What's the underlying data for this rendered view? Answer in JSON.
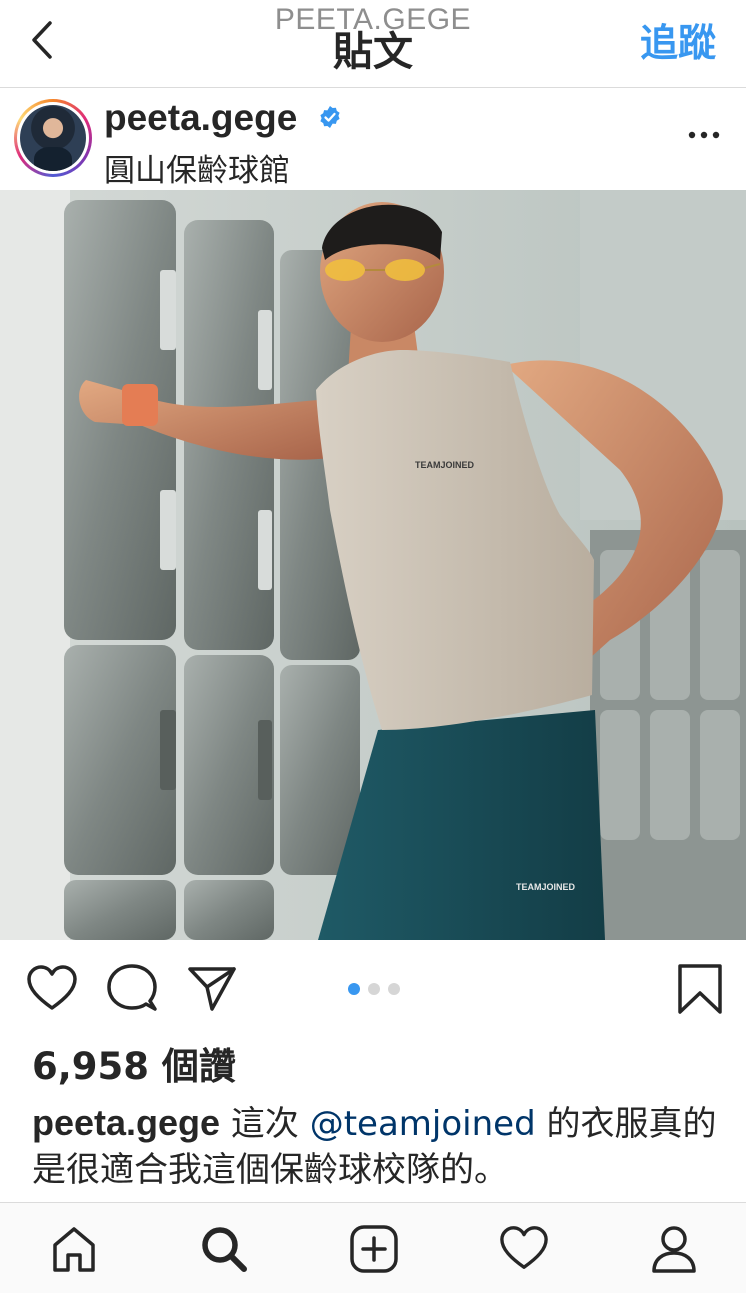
{
  "nav": {
    "username": "PEETA.GEGE",
    "title": "貼文",
    "follow_label": "追蹤"
  },
  "post": {
    "username": "peeta.gege",
    "verified": true,
    "location": "圓山保齡球館",
    "photo_text_chest": "TEAMJOINED",
    "photo_text_shorts": "TEAMJOINED",
    "carousel": {
      "count": 3,
      "active_index": 1
    },
    "likes": "6,958 個讚",
    "caption": {
      "username": "peeta.gege",
      "text_before": " 這次 ",
      "mention": "@teamjoined",
      "text_after": " 的衣服真的是很適合我這個保齡球校隊的。"
    }
  },
  "icons": {
    "back": "chevron-left-icon",
    "more": "more-horizontal-icon",
    "like": "heart-icon",
    "comment": "comment-bubble-icon",
    "share": "paper-plane-icon",
    "save": "bookmark-icon",
    "tabs": [
      "home-icon",
      "search-icon",
      "add-post-icon",
      "activity-heart-icon",
      "profile-icon"
    ]
  },
  "colors": {
    "accent": "#3897f0",
    "mention": "#003569",
    "text": "#262626",
    "muted": "#8e8e8e"
  }
}
